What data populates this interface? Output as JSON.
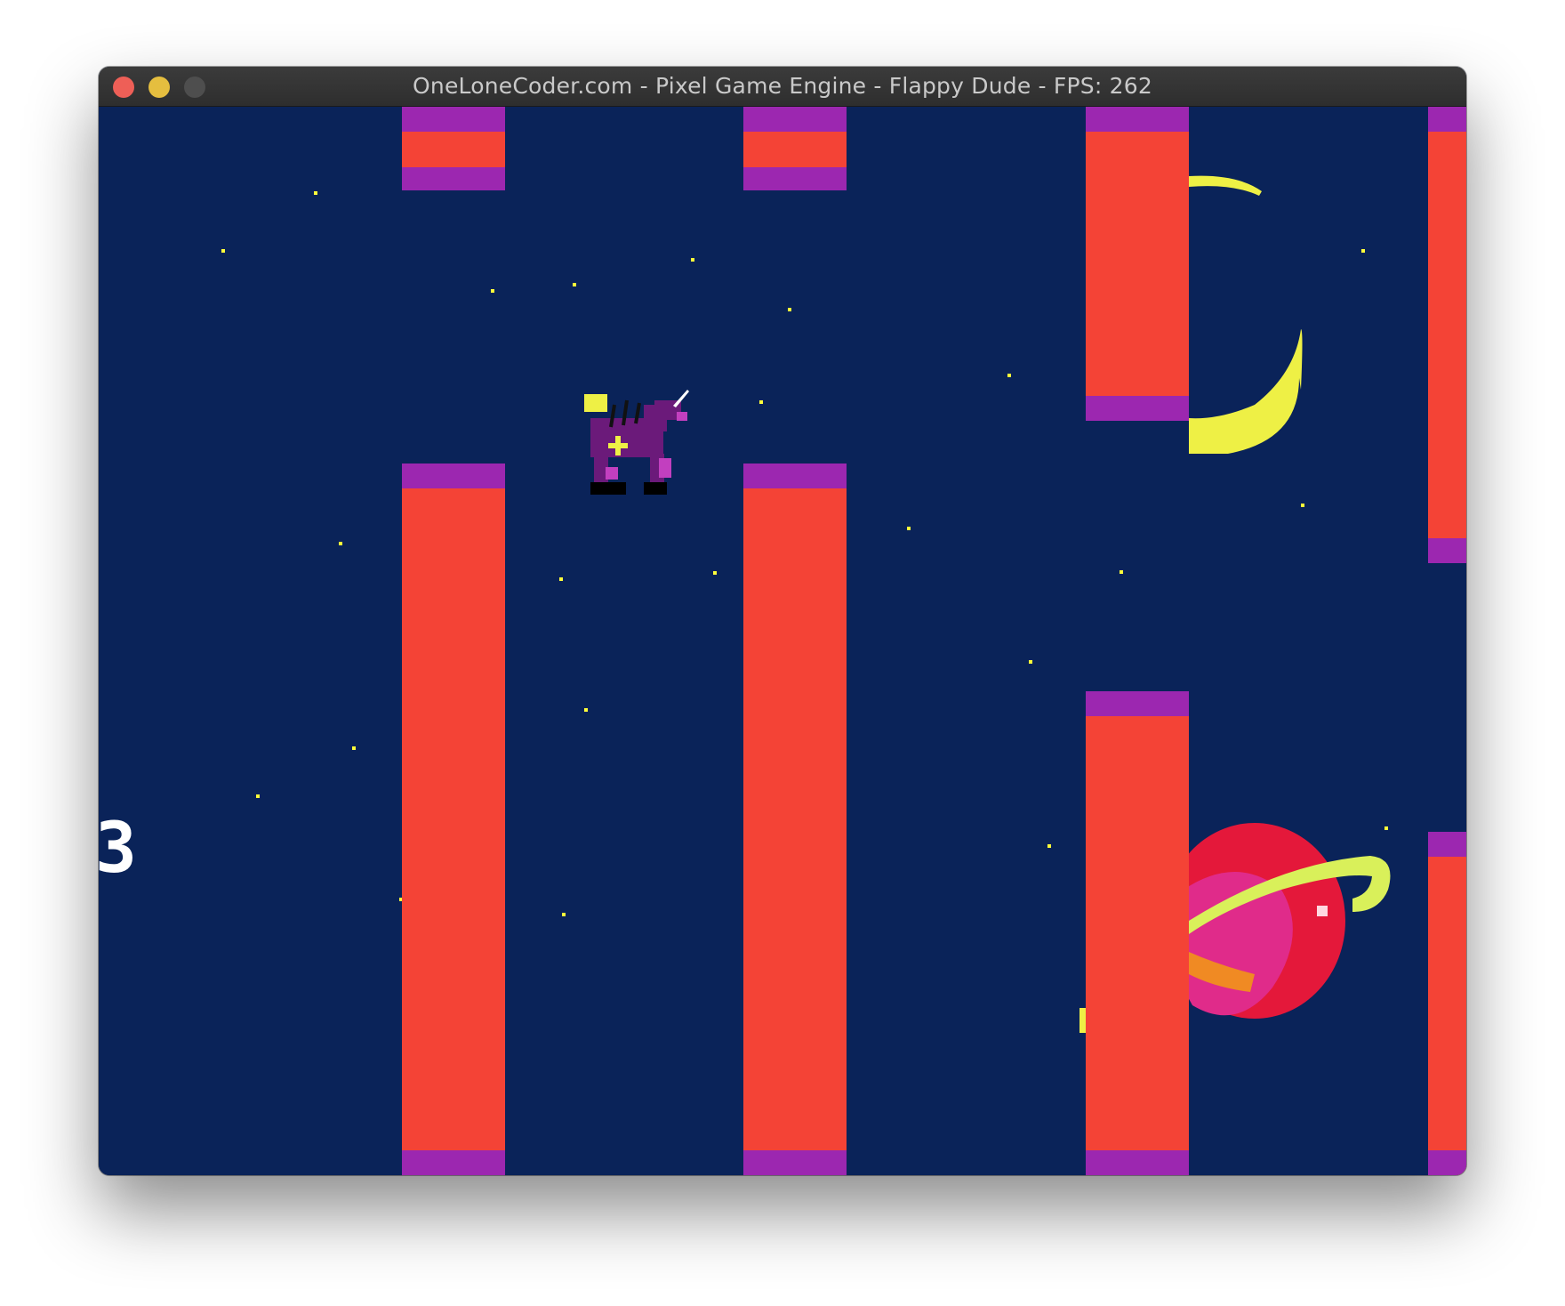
{
  "window": {
    "title": "OneLoneCoder.com - Pixel Game Engine - Flappy Dude - FPS: 262"
  },
  "game": {
    "score": "3",
    "colors": {
      "sky": "#0a2359",
      "pipe_body": "#f44336",
      "pipe_cap": "#9c27b0",
      "star": "#ffff3a",
      "moon": "#eef045",
      "planet_red": "#e4183a",
      "planet_pink": "#e02b8a",
      "ring": "#d9f05a",
      "player": "#6b1a7a"
    },
    "sprites": {
      "player": "unicorn-sprite",
      "moon": "crescent-moon",
      "planet": "ringed-planet"
    }
  }
}
